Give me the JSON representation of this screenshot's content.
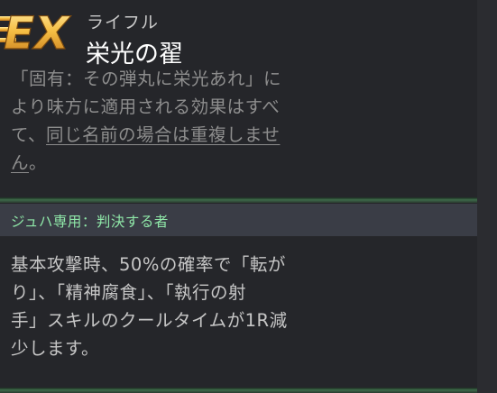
{
  "header": {
    "logo": "EX",
    "item_type": "ライフル",
    "item_name": "栄光の翟"
  },
  "description": {
    "lines": [
      "「固有：その弾丸に栄光あれ」に",
      "より味方に適用される効果はすべ",
      "て、",
      "同じ名前の場合は重複しませ",
      "ん",
      "。"
    ]
  },
  "exclusive": {
    "label": "ジュハ専用：判決する者",
    "lines": [
      "基本攻撃時、50%の確率で「転が",
      "り」、「精神腐食」、「執行の射",
      "手」スキルのクールタイムが1R減",
      "少します。"
    ]
  },
  "colors": {
    "background": "#25262a",
    "accent_green": "#8fe7a8",
    "logo_gold": "#f3b73a"
  }
}
